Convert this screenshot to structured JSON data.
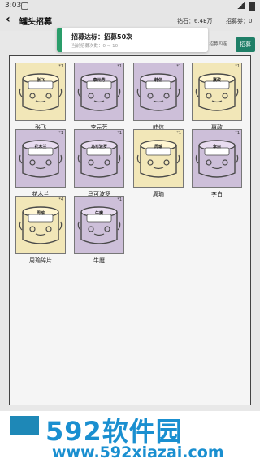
{
  "status_bar": {
    "time": "3:03"
  },
  "app_bar": {
    "back_label": "‹",
    "title": "罐头招募",
    "diamond_text": "钻石：6.4E万",
    "recruits_text": "招募券：0"
  },
  "toast": {
    "title": "招募达标：招募50次",
    "subtitle": "当前招募次数：0 ⇒ 10"
  },
  "buttons": {
    "recruit_mode": "招募四连",
    "recruit": "招募"
  },
  "colors": {
    "accent": "#1f7f67",
    "toast_bar": "#2a9d6a",
    "gold_card": "#f2e7b8",
    "purple_card": "#cdbfd9",
    "watermark_blue": "#1a8fd0"
  },
  "cards": [
    {
      "name": "张飞",
      "plate": "张飞",
      "count": "*1",
      "rarity": "gold"
    },
    {
      "name": "李元芳",
      "plate": "李元芳",
      "count": "*1",
      "rarity": "purple"
    },
    {
      "name": "韩信",
      "plate": "韩信",
      "count": "*1",
      "rarity": "purple"
    },
    {
      "name": "嬴政",
      "plate": "嬴政",
      "count": "*1",
      "rarity": "gold"
    },
    {
      "name": "花木兰",
      "plate": "花木兰",
      "count": "*1",
      "rarity": "purple"
    },
    {
      "name": "马可波罗",
      "plate": "马可波罗",
      "count": "*1",
      "rarity": "purple"
    },
    {
      "name": "周瑜",
      "plate": "周瑜",
      "count": "*1",
      "rarity": "gold"
    },
    {
      "name": "李白",
      "plate": "李白",
      "count": "*1",
      "rarity": "purple"
    },
    {
      "name": "周瑜碎片",
      "plate": "周瑜",
      "count": "*4",
      "rarity": "gold"
    },
    {
      "name": "牛魔",
      "plate": "牛魔",
      "count": "*1",
      "rarity": "purple"
    }
  ],
  "watermark": {
    "brand": "592软件园",
    "site": "www.592xiazai.com"
  }
}
